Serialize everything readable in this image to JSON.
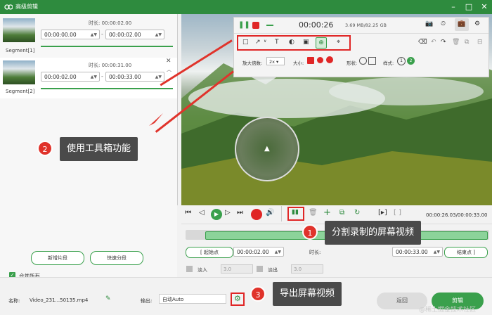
{
  "window": {
    "title": "高级剪辑"
  },
  "segments": [
    {
      "label": "Segment[1]",
      "duration_label": "时长:",
      "duration": "00:00:02.00",
      "start": "00:00:00.00",
      "end": "00:00:02.00"
    },
    {
      "label": "Segment[2]",
      "duration_label": "时长:",
      "duration": "00:00:31.00",
      "start": "00:00:02.00",
      "end": "00:00:33.00"
    }
  ],
  "left_actions": {
    "add_segment": "新增片段",
    "quick_split": "快速分段",
    "merge_all": "合并所有"
  },
  "rec_toolbar": {
    "timer": "00:00:26",
    "size": "3.69 MB/82.25 GB",
    "zoom_label": "放大倍数:",
    "zoom_value": "2x",
    "size_label": "大小:",
    "shape_label": "形状:",
    "style_label": "样式:",
    "style_1": "1",
    "style_2": "2"
  },
  "controls": {
    "time_display": "00:00:26.03/00:00:33.00",
    "start_point": "起始点",
    "start_value": "00:00:02.00",
    "duration_label": "时长:",
    "end_value": "00:00:33.00",
    "end_point": "结束点",
    "fade_in": "淡入",
    "fade_in_value": "3.0",
    "fade_out": "淡出",
    "fade_out_value": "3.0"
  },
  "bottom": {
    "name_label": "名称:",
    "name_value": "Video_231...50135.mp4",
    "output_label": "输出:",
    "output_value": "自动Auto",
    "return_button": "返回",
    "clip_button": "剪辑"
  },
  "callouts": {
    "c1": {
      "num": "1",
      "text": "分割录制的屏幕视频"
    },
    "c2": {
      "num": "2",
      "text": "使用工具箱功能"
    },
    "c3": {
      "num": "3",
      "text": "导出屏幕视频"
    }
  },
  "watermark": "@稀土掘金技术社区",
  "colors": {
    "accent": "#3aa04c",
    "title_bar": "#2e8b3e",
    "highlight": "#e02626",
    "callout_bg": "#4a4a4a"
  }
}
